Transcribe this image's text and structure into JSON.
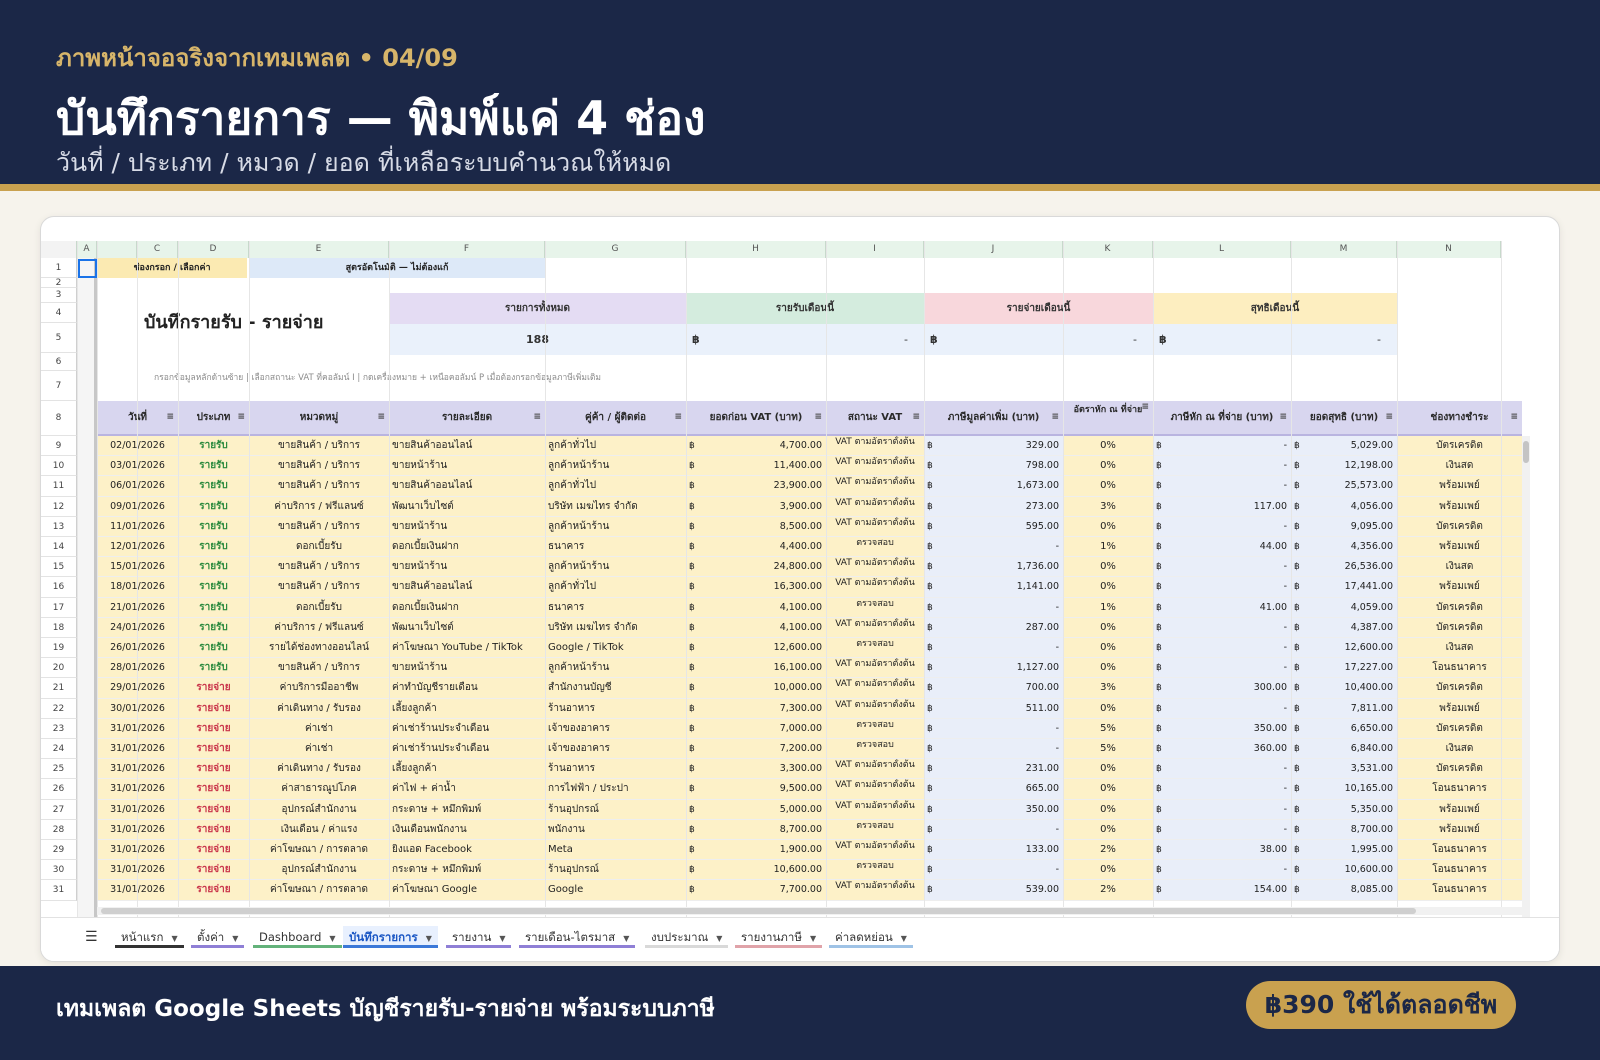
{
  "header": {
    "kicker": "ภาพหน้าจอจริงจากเทมเพลต • 04/09",
    "title": "บันทึกรายการ — พิมพ์แค่ 4 ช่อง",
    "subtitle": "วันที่ / ประเภท / หมวด / ยอด ที่เหลือระบบคำนวณให้หมด"
  },
  "sheet": {
    "columns": [
      "A",
      "",
      "C",
      "D",
      "E",
      "F",
      "G",
      "H",
      "I",
      "J",
      "K",
      "L",
      "M",
      "N"
    ],
    "legend_input": "ช่องกรอก / เลือกค่า",
    "legend_auto": "สูตรอัตโนมัติ — ไม่ต้องแก้",
    "sheet_title": "บันทึกรายรับ - รายจ่าย",
    "hint": "กรอกข้อมูลหลักด้านซ้าย | เลือกสถานะ VAT ที่คอลัมน์ I | กดเครื่องหมาย + เหนือคอลัมน์ P เมื่อต้องกรอกข้อมูลภาษีเพิ่มเติม",
    "summary": {
      "total_label": "รายการทั้งหมด",
      "total_value": "188",
      "income_label": "รายรับเดือนนี้",
      "income_value": "-",
      "expense_label": "รายจ่ายเดือนนี้",
      "expense_value": "-",
      "net_label": "สุทธิเดือนนี้",
      "net_value": "-",
      "currency": "฿"
    },
    "table_headers": [
      "วันที่",
      "ประเภท",
      "หมวดหมู่",
      "รายละเอียด",
      "คู่ค้า / ผู้ติดต่อ",
      "ยอดก่อน VAT (บาท)",
      "สถานะ VAT",
      "ภาษีมูลค่าเพิ่ม (บาท)",
      "อัตราหัก ณ ที่จ่าย",
      "ภาษีหัก ณ ที่จ่าย (บาท)",
      "ยอดสุทธิ (บาท)",
      "ช่องทางชำระ"
    ],
    "row_numbers": [
      "1",
      "2",
      "3",
      "4",
      "5",
      "6",
      "7",
      "8",
      "9",
      "10",
      "11",
      "12",
      "13",
      "14",
      "15",
      "16",
      "17",
      "18",
      "19",
      "20",
      "21",
      "22",
      "23",
      "24",
      "25",
      "26",
      "27",
      "28",
      "29",
      "30",
      "31"
    ],
    "rows": [
      [
        "02/01/2026",
        "รายรับ",
        "ขายสินค้า / บริการ",
        "ขายสินค้าออนไลน์",
        "ลูกค้าทั่วไป",
        "4,700.00",
        "VAT ตามอัตราตั้งต้น",
        "329.00",
        "0%",
        "-",
        "5,029.00",
        "บัตรเครดิต"
      ],
      [
        "03/01/2026",
        "รายรับ",
        "ขายสินค้า / บริการ",
        "ขายหน้าร้าน",
        "ลูกค้าหน้าร้าน",
        "11,400.00",
        "VAT ตามอัตราตั้งต้น",
        "798.00",
        "0%",
        "-",
        "12,198.00",
        "เงินสด"
      ],
      [
        "06/01/2026",
        "รายรับ",
        "ขายสินค้า / บริการ",
        "ขายสินค้าออนไลน์",
        "ลูกค้าทั่วไป",
        "23,900.00",
        "VAT ตามอัตราตั้งต้น",
        "1,673.00",
        "0%",
        "-",
        "25,573.00",
        "พร้อมเพย์"
      ],
      [
        "09/01/2026",
        "รายรับ",
        "ค่าบริการ / ฟรีแลนซ์",
        "พัฒนาเว็บไซต์",
        "บริษัท เมฆไทร จำกัด",
        "3,900.00",
        "VAT ตามอัตราตั้งต้น",
        "273.00",
        "3%",
        "117.00",
        "4,056.00",
        "พร้อมเพย์"
      ],
      [
        "11/01/2026",
        "รายรับ",
        "ขายสินค้า / บริการ",
        "ขายหน้าร้าน",
        "ลูกค้าหน้าร้าน",
        "8,500.00",
        "VAT ตามอัตราตั้งต้น",
        "595.00",
        "0%",
        "-",
        "9,095.00",
        "บัตรเครดิต"
      ],
      [
        "12/01/2026",
        "รายรับ",
        "ดอกเบี้ยรับ",
        "ดอกเบี้ยเงินฝาก",
        "ธนาคาร",
        "4,400.00",
        "ตรวจสอบ",
        "-",
        "1%",
        "44.00",
        "4,356.00",
        "พร้อมเพย์"
      ],
      [
        "15/01/2026",
        "รายรับ",
        "ขายสินค้า / บริการ",
        "ขายหน้าร้าน",
        "ลูกค้าหน้าร้าน",
        "24,800.00",
        "VAT ตามอัตราตั้งต้น",
        "1,736.00",
        "0%",
        "-",
        "26,536.00",
        "เงินสด"
      ],
      [
        "18/01/2026",
        "รายรับ",
        "ขายสินค้า / บริการ",
        "ขายสินค้าออนไลน์",
        "ลูกค้าทั่วไป",
        "16,300.00",
        "VAT ตามอัตราตั้งต้น",
        "1,141.00",
        "0%",
        "-",
        "17,441.00",
        "พร้อมเพย์"
      ],
      [
        "21/01/2026",
        "รายรับ",
        "ดอกเบี้ยรับ",
        "ดอกเบี้ยเงินฝาก",
        "ธนาคาร",
        "4,100.00",
        "ตรวจสอบ",
        "-",
        "1%",
        "41.00",
        "4,059.00",
        "บัตรเครดิต"
      ],
      [
        "24/01/2026",
        "รายรับ",
        "ค่าบริการ / ฟรีแลนซ์",
        "พัฒนาเว็บไซต์",
        "บริษัท เมฆไทร จำกัด",
        "4,100.00",
        "VAT ตามอัตราตั้งต้น",
        "287.00",
        "0%",
        "-",
        "4,387.00",
        "บัตรเครดิต"
      ],
      [
        "26/01/2026",
        "รายรับ",
        "รายได้ช่องทางออนไลน์",
        "ค่าโฆษณา YouTube / TikTok",
        "Google / TikTok",
        "12,600.00",
        "ตรวจสอบ",
        "-",
        "0%",
        "-",
        "12,600.00",
        "เงินสด"
      ],
      [
        "28/01/2026",
        "รายรับ",
        "ขายสินค้า / บริการ",
        "ขายหน้าร้าน",
        "ลูกค้าหน้าร้าน",
        "16,100.00",
        "VAT ตามอัตราตั้งต้น",
        "1,127.00",
        "0%",
        "-",
        "17,227.00",
        "โอนธนาคาร"
      ],
      [
        "29/01/2026",
        "รายจ่าย",
        "ค่าบริการมืออาชีพ",
        "ค่าทำบัญชีรายเดือน",
        "สำนักงานบัญชี",
        "10,000.00",
        "VAT ตามอัตราตั้งต้น",
        "700.00",
        "3%",
        "300.00",
        "10,400.00",
        "บัตรเครดิต"
      ],
      [
        "30/01/2026",
        "รายจ่าย",
        "ค่าเดินทาง / รับรอง",
        "เลี้ยงลูกค้า",
        "ร้านอาหาร",
        "7,300.00",
        "VAT ตามอัตราตั้งต้น",
        "511.00",
        "0%",
        "-",
        "7,811.00",
        "พร้อมเพย์"
      ],
      [
        "31/01/2026",
        "รายจ่าย",
        "ค่าเช่า",
        "ค่าเช่าร้านประจำเดือน",
        "เจ้าของอาคาร",
        "7,000.00",
        "ตรวจสอบ",
        "-",
        "5%",
        "350.00",
        "6,650.00",
        "บัตรเครดิต"
      ],
      [
        "31/01/2026",
        "รายจ่าย",
        "ค่าเช่า",
        "ค่าเช่าร้านประจำเดือน",
        "เจ้าของอาคาร",
        "7,200.00",
        "ตรวจสอบ",
        "-",
        "5%",
        "360.00",
        "6,840.00",
        "เงินสด"
      ],
      [
        "31/01/2026",
        "รายจ่าย",
        "ค่าเดินทาง / รับรอง",
        "เลี้ยงลูกค้า",
        "ร้านอาหาร",
        "3,300.00",
        "VAT ตามอัตราตั้งต้น",
        "231.00",
        "0%",
        "-",
        "3,531.00",
        "บัตรเครดิต"
      ],
      [
        "31/01/2026",
        "รายจ่าย",
        "ค่าสาธารณูปโภค",
        "ค่าไฟ + ค่าน้ำ",
        "การไฟฟ้า / ประปา",
        "9,500.00",
        "VAT ตามอัตราตั้งต้น",
        "665.00",
        "0%",
        "-",
        "10,165.00",
        "โอนธนาคาร"
      ],
      [
        "31/01/2026",
        "รายจ่าย",
        "อุปกรณ์สำนักงาน",
        "กระดาษ + หมึกพิมพ์",
        "ร้านอุปกรณ์",
        "5,000.00",
        "VAT ตามอัตราตั้งต้น",
        "350.00",
        "0%",
        "-",
        "5,350.00",
        "พร้อมเพย์"
      ],
      [
        "31/01/2026",
        "รายจ่าย",
        "เงินเดือน / ค่าแรง",
        "เงินเดือนพนักงาน",
        "พนักงาน",
        "8,700.00",
        "ตรวจสอบ",
        "-",
        "0%",
        "-",
        "8,700.00",
        "พร้อมเพย์"
      ],
      [
        "31/01/2026",
        "รายจ่าย",
        "ค่าโฆษณา / การตลาด",
        "ยิงแอด Facebook",
        "Meta",
        "1,900.00",
        "VAT ตามอัตราตั้งต้น",
        "133.00",
        "2%",
        "38.00",
        "1,995.00",
        "โอนธนาคาร"
      ],
      [
        "31/01/2026",
        "รายจ่าย",
        "อุปกรณ์สำนักงาน",
        "กระดาษ + หมึกพิมพ์",
        "ร้านอุปกรณ์",
        "10,600.00",
        "ตรวจสอบ",
        "-",
        "0%",
        "-",
        "10,600.00",
        "โอนธนาคาร"
      ],
      [
        "31/01/2026",
        "รายจ่าย",
        "ค่าโฆษณา / การตลาด",
        "ค่าโฆษณา Google",
        "Google",
        "7,700.00",
        "VAT ตามอัตราตั้งต้น",
        "539.00",
        "2%",
        "154.00",
        "8,085.00",
        "โอนธนาคาร"
      ]
    ]
  },
  "tabs": [
    {
      "label": "หน้าแรก",
      "color": "#333333"
    },
    {
      "label": "ตั้งค่า",
      "color": "#8f7fd6"
    },
    {
      "label": "Dashboard",
      "color": "#63b27a"
    },
    {
      "label": "บันทึกรายการ",
      "color": "#3b78d8"
    },
    {
      "label": "รายงาน",
      "color": "#8f7fd6"
    },
    {
      "label": "รายเดือน-ไตรมาส",
      "color": "#8f7fd6"
    },
    {
      "label": "งบประมาณ",
      "color": "#d9d9d9"
    },
    {
      "label": "รายงานภาษี",
      "color": "#e0a3a9"
    },
    {
      "label": "ค่าลดหย่อน",
      "color": "#9fc3e6"
    }
  ],
  "footer": {
    "text": "เทมเพลต Google Sheets บัญชีรายรับ-รายจ่าย พร้อมระบบภาษี",
    "price": "฿390 ใช้ได้ตลอดชีพ"
  },
  "colors": {
    "navy": "#1b2747",
    "gold": "#c9a14f",
    "income": "#2b8a3e",
    "expense": "#c9344a"
  }
}
